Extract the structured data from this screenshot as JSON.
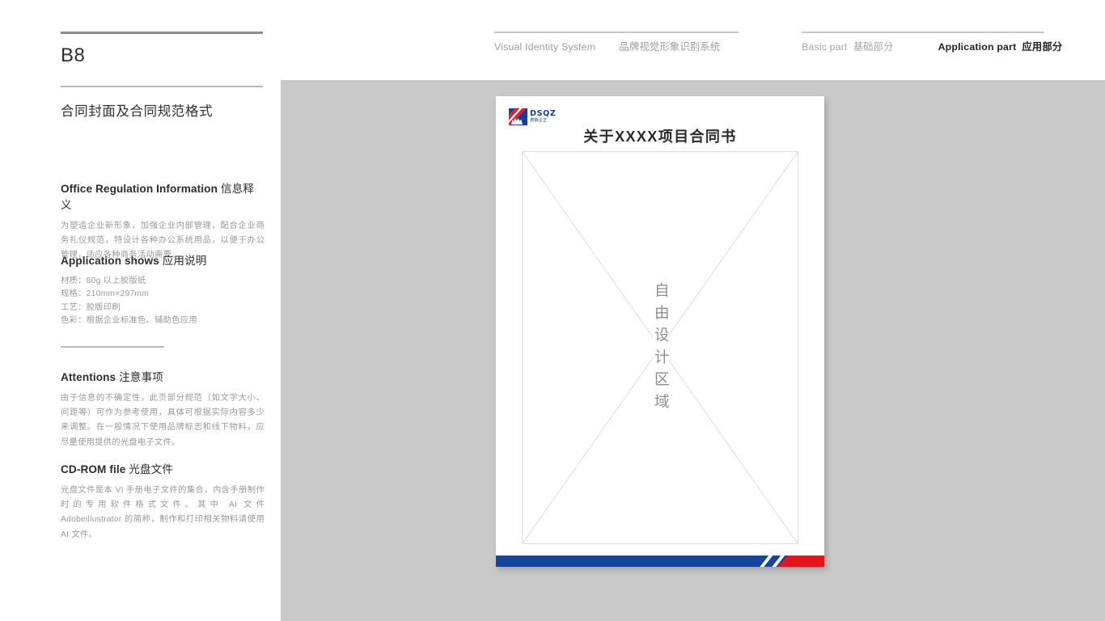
{
  "sidebar": {
    "code": "B8",
    "section_title": "合同封面及合同规范格式",
    "blocks": [
      {
        "heading_en": "Office Regulation Information",
        "heading_cn": "信息释义",
        "body": "为塑造企业新形象，加强企业内部管理，配合企业商务礼仪规范，特设计各种办公系统用品，以便于办公管理，适应各种商务活动需要。"
      },
      {
        "heading_en": "Application shows",
        "heading_cn": "应用说明",
        "specs": [
          "材质：80g 以上胶版纸",
          "规格：210mm×297mm",
          "工艺：胶版印刷",
          "色彩：根据企业标准色、辅助色应用"
        ]
      },
      {
        "heading_en": "Attentions",
        "heading_cn": "注意事项",
        "body": "由于信息的不确定性，此页部分规范（如文字大小、间距等）可作为参考使用，具体可根据实际内容多少来调整。在一般情况下使用品牌标志和线下物料，应尽量使用提供的光盘电子文件。"
      },
      {
        "heading_en": "CD-ROM file",
        "heading_cn": "光盘文件",
        "body": "光盘文件是本 VI 手册电子文件的集合，内含手册制作时的专用软件格式文件。其中 AI 文件 Adobeillustrator 的简称，制作和打印相关物料请使用 AI 文件。"
      }
    ]
  },
  "topnav": {
    "system_en": "Visual Identity System",
    "system_cn": "品牌视觉形象识别系统",
    "basic_en": "Basic part",
    "basic_cn": "基础部分",
    "application_en": "Application part",
    "application_cn": "应用部分"
  },
  "document": {
    "logo_text_main": "DSQZ",
    "logo_text_sub": "德森企正",
    "title": "关于XXXX项目合同书",
    "placeholder_text": "自由设计区域"
  },
  "colors": {
    "brand_blue": "#12459c",
    "brand_red": "#e3141c",
    "stage_gray": "#c9c9c9",
    "body_text_gray": "#999999"
  }
}
